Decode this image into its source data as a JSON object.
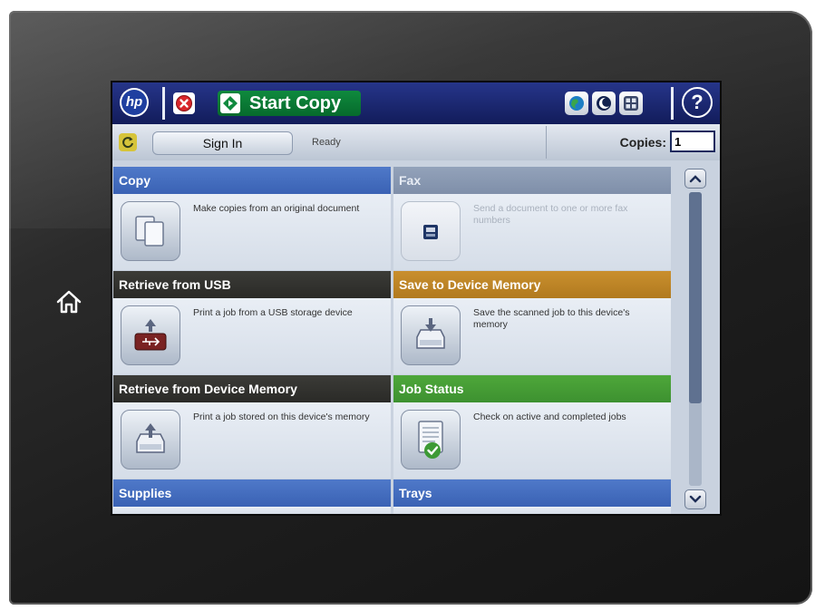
{
  "topbar": {
    "logo_text": "hp",
    "start_label": "Start Copy",
    "icons": [
      "stop-icon",
      "start-icon",
      "globe-icon",
      "sleep-icon",
      "network-icon",
      "help-icon"
    ],
    "help_label": "?"
  },
  "statusbar": {
    "sign_in_label": "Sign In",
    "status": "Ready",
    "copies_label": "Copies:",
    "copies_value": "1"
  },
  "tiles": [
    {
      "title": "Copy",
      "description": "Make copies from an original document",
      "icon": "copy-icon",
      "state": "enabled",
      "color": "#4f79c9"
    },
    {
      "title": "Fax",
      "description": "Send a document to one or more fax numbers",
      "icon": "fax-icon",
      "state": "disabled",
      "color": "#93a2ba"
    },
    {
      "title": "Retrieve from USB",
      "description": "Print a job from a USB storage device",
      "icon": "usb-icon",
      "state": "enabled",
      "color": "#3b3b37"
    },
    {
      "title": "Save to Device Memory",
      "description": "Save the scanned job to this device's memory",
      "icon": "save-drive-icon",
      "state": "enabled",
      "color": "#c98f2e"
    },
    {
      "title": "Retrieve from Device Memory",
      "description": "Print a job stored on this device's memory",
      "icon": "retrieve-drive-icon",
      "state": "enabled",
      "color": "#3b3b37"
    },
    {
      "title": "Job Status",
      "description": "Check on active and completed jobs",
      "icon": "job-status-icon",
      "state": "enabled",
      "color": "#4ea73a"
    },
    {
      "title": "Supplies",
      "icon": "supplies-icon",
      "state": "enabled",
      "color": "#4f79c9"
    },
    {
      "title": "Trays",
      "icon": "trays-icon",
      "state": "enabled",
      "color": "#4f79c9"
    }
  ],
  "scrollbar": {
    "position": 0.0,
    "visible_fraction": 0.72
  },
  "device": {
    "home_icon": "home-icon"
  }
}
